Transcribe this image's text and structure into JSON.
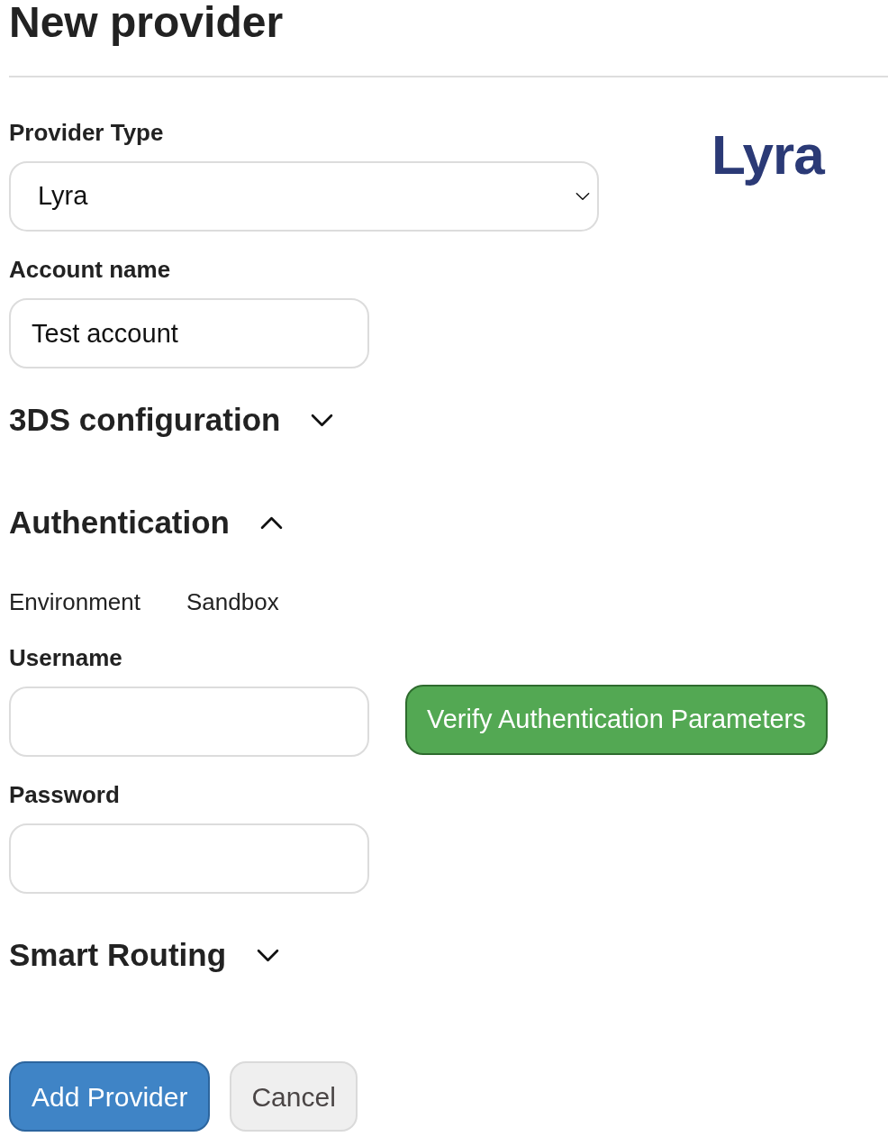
{
  "page": {
    "title": "New provider"
  },
  "provider_type": {
    "label": "Provider Type",
    "value": "Lyra"
  },
  "logo": {
    "text": "Lyra"
  },
  "account_name": {
    "label": "Account name",
    "value": "Test account"
  },
  "sections": [
    {
      "title": "3DS configuration",
      "expanded": false
    },
    {
      "title": "Authentication",
      "expanded": true,
      "environment": {
        "label": "Environment",
        "value": "Sandbox"
      },
      "fields": [
        {
          "label": "Username"
        },
        {
          "label": "Password"
        }
      ],
      "verify_button": {
        "label": "Verify Authentication Parameters"
      }
    },
    {
      "title": "Smart Routing",
      "expanded": false
    }
  ],
  "buttons": [
    {
      "label": "Add Provider",
      "kind": "primary"
    },
    {
      "label": "Cancel",
      "kind": "secondary"
    }
  ]
}
